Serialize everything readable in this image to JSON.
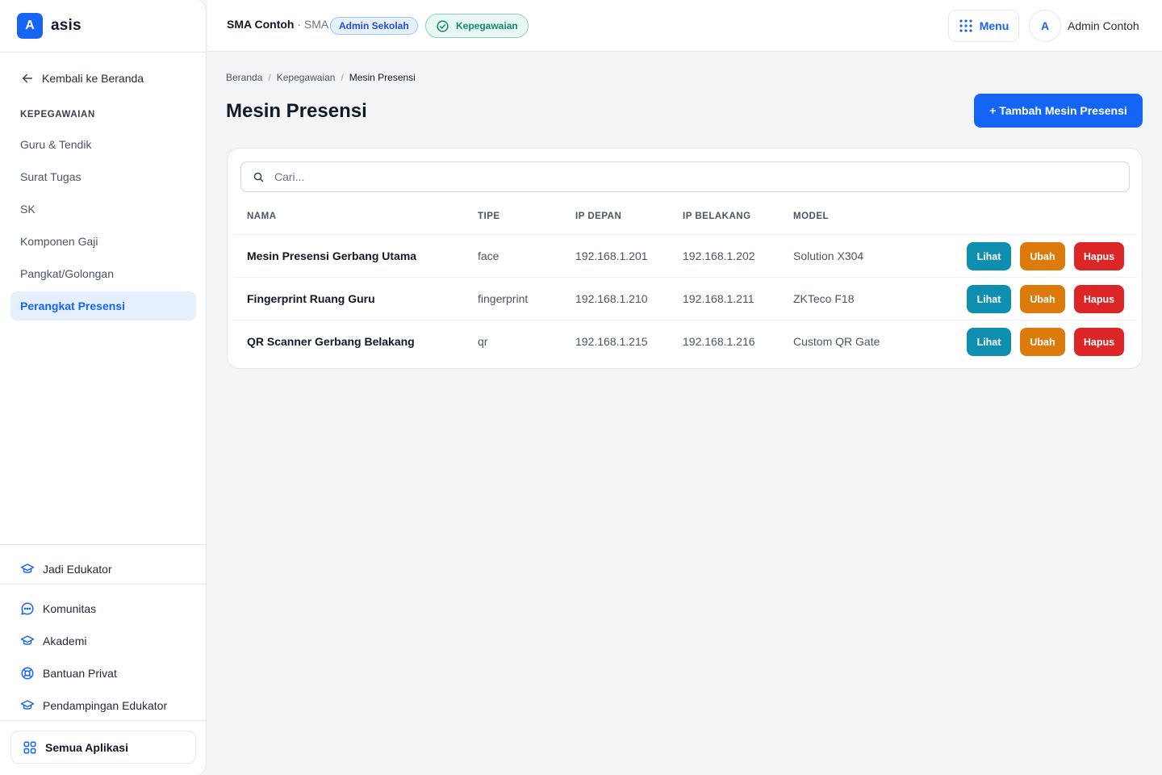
{
  "brand": {
    "logo": "A",
    "name": "asis"
  },
  "sidebar": {
    "back": "Kembali ke Beranda",
    "section": "KEPEGAWAIAN",
    "items": [
      {
        "label": "Guru & Tendik"
      },
      {
        "label": "Surat Tugas"
      },
      {
        "label": "SK"
      },
      {
        "label": "Komponen Gaji"
      },
      {
        "label": "Pangkat/Golongan"
      },
      {
        "label": "Perangkat Presensi",
        "active": true
      }
    ],
    "bottom": {
      "edukator": "Jadi Edukator",
      "komunitas": "Komunitas",
      "akademi": "Akademi",
      "bantuan": "Bantuan Privat",
      "pendampingan": "Pendampingan Edukator",
      "all_apps": "Semua Aplikasi"
    }
  },
  "header": {
    "school": "SMA Contoh",
    "school_sep": " · ",
    "school_type": "SMA",
    "role_badge": "Admin Sekolah",
    "module_badge": "Kepegawaian",
    "menu": "Menu",
    "avatar": "A",
    "user": "Admin Contoh"
  },
  "breadcrumb": [
    "Beranda",
    "Kepegawaian",
    "Mesin Presensi"
  ],
  "breadcrumb_sep": "/",
  "page": {
    "title": "Mesin Presensi",
    "add_button": "+ Tambah Mesin Presensi"
  },
  "search": {
    "placeholder": "Cari..."
  },
  "table": {
    "headers": [
      "NAMA",
      "TIPE",
      "IP DEPAN",
      "IP BELAKANG",
      "MODEL"
    ],
    "rows": [
      {
        "name": "Mesin Presensi Gerbang Utama",
        "type": "face",
        "ip_front": "192.168.1.201",
        "ip_back": "192.168.1.202",
        "model": "Solution X304"
      },
      {
        "name": "Fingerprint Ruang Guru",
        "type": "fingerprint",
        "ip_front": "192.168.1.210",
        "ip_back": "192.168.1.211",
        "model": "ZKTeco F18"
      },
      {
        "name": "QR Scanner Gerbang Belakang",
        "type": "qr",
        "ip_front": "192.168.1.215",
        "ip_back": "192.168.1.216",
        "model": "Custom QR Gate"
      }
    ],
    "actions": {
      "view": "Lihat",
      "edit": "Ubah",
      "delete": "Hapus"
    }
  },
  "colors": {
    "primary": "#1565f5",
    "view": "#0f8fb0",
    "edit": "#dc7a0c",
    "delete": "#dc2626",
    "success": "#0f8a6a"
  }
}
